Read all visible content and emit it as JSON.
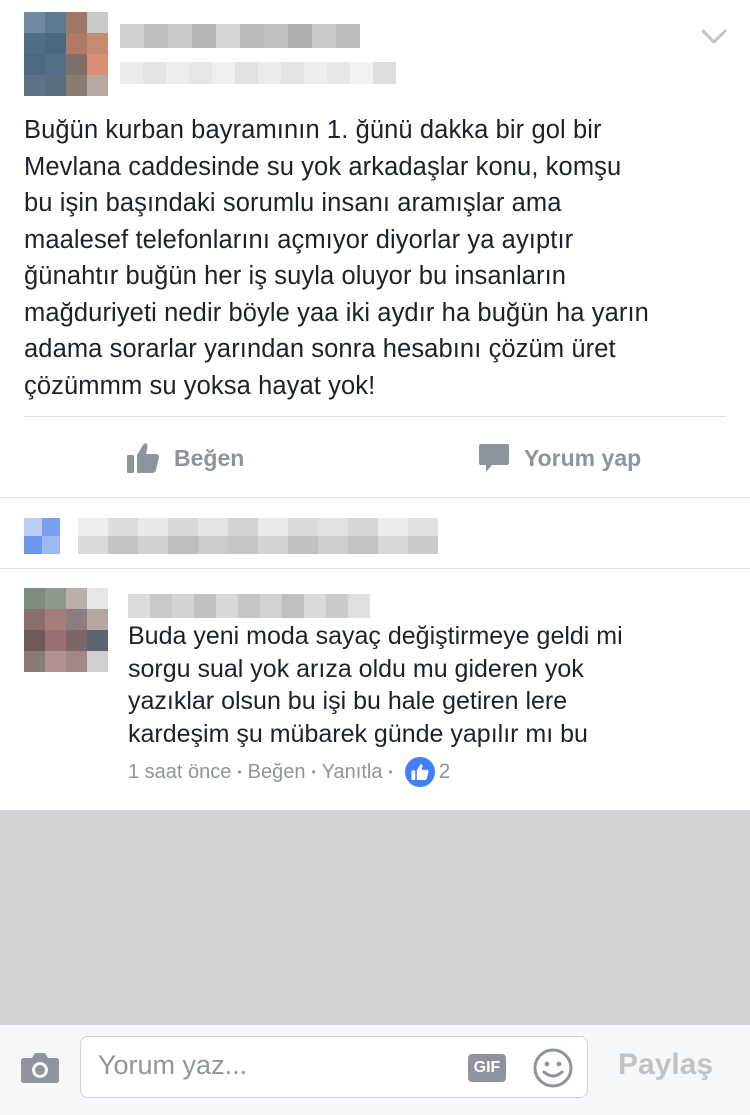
{
  "post": {
    "text": "Buğün kurban bayramının 1.  ğünü dakka bir gol bir\nMevlana caddesinde su yok arkadaşlar konu, komşu\nbu işin başındaki sorumlu insanı aramışlar ama\nmaalesef telefonlarını açmıyor diyorlar ya ayıptır\nğünahtır buğün her iş suyla oluyor  bu insanların\nmağduriyeti nedir böyle yaa iki aydır ha buğün ha yarın\nadama sorarlar yarından sonra hesabını çözüm üret\nçözümmm su yoksa hayat yok!",
    "like_label": "Beğen",
    "comment_label": "Yorum yap"
  },
  "comment": {
    "text": "Buda yeni moda sayaç değiştirmeye geldi mi\nsorgu sual yok arıza oldu mu gideren yok\nyazıklar  olsun bu işi bu hale getiren lere\nkardeşim şu mübarek günde yapılır mı bu",
    "time": "1 saat önce",
    "like_label": "Beğen",
    "reply_label": "Yanıtla",
    "separator": "•",
    "reaction_count": "2"
  },
  "composer": {
    "placeholder": "Yorum yaz...",
    "gif_label": "GIF",
    "share_label": "Paylaş"
  },
  "icons": {
    "chevron": "chevron-down-icon",
    "like": "thumbs-up-icon",
    "comment": "speech-bubble-icon",
    "camera": "camera-icon",
    "emoji": "smiley-icon"
  },
  "colors": {
    "accent": "#4080ff",
    "muted": "#8d949e",
    "gray_area": "#d0d2d6"
  }
}
